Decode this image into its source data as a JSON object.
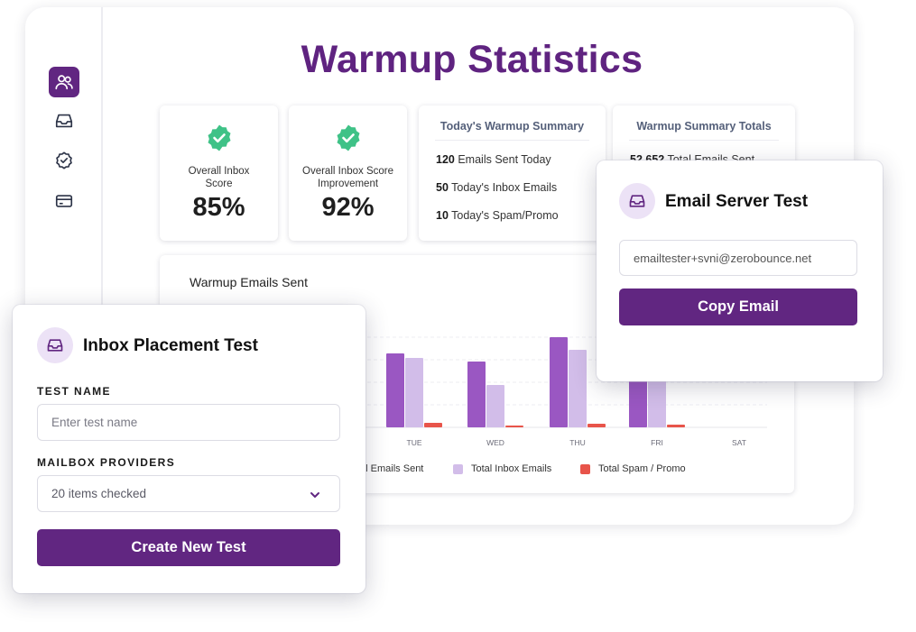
{
  "page": {
    "title": "Warmup Statistics"
  },
  "colors": {
    "brand": "#612681",
    "check_badge": "#3fc287",
    "sent_bar": "#9a57c2",
    "inbox_bar": "#d2bde9",
    "spam_bar": "#e8544a"
  },
  "sidebar": {
    "icons": [
      "users-icon",
      "inbox-icon",
      "badge-check-icon",
      "credit-card-icon"
    ],
    "active": "users-icon"
  },
  "score_cards": [
    {
      "label_line1": "Overall Inbox",
      "label_line2": "Score",
      "value": "85%"
    },
    {
      "label_line1": "Overall Inbox Score",
      "label_line2": "Improvement",
      "value": "92%"
    }
  ],
  "today_summary": {
    "title": "Today's Warmup Summary",
    "lines": [
      {
        "count": "120",
        "text": "Emails Sent Today"
      },
      {
        "count": "50",
        "text": "Today's Inbox Emails"
      },
      {
        "count": "10",
        "text": "Today's Spam/Promo"
      }
    ]
  },
  "totals_summary": {
    "title": "Warmup Summary Totals",
    "first_line": {
      "count": "52,652",
      "text": "Total Emails Sent"
    }
  },
  "chart_data": {
    "type": "bar",
    "title": "Warmup Emails Sent",
    "categories": [
      "TUE",
      "WED",
      "THU",
      "FRI",
      "SAT"
    ],
    "series": [
      {
        "name": "Total Emails Sent",
        "values": [
          82,
          73,
          100,
          88,
          0
        ]
      },
      {
        "name": "Total Inbox Emails",
        "values": [
          77,
          47,
          86,
          84,
          0
        ]
      },
      {
        "name": "Total Spam / Promo",
        "values": [
          5,
          2,
          4,
          3,
          0
        ]
      }
    ],
    "ylim": [
      0,
      110
    ],
    "grid": true,
    "legend_position": "bottom",
    "legend_visible_text": [
      "tal Emails Sent",
      "Total Inbox Emails",
      "Total Spam / Promo"
    ]
  },
  "inbox_placement": {
    "title": "Inbox Placement Test",
    "test_name_label": "TEST NAME",
    "test_name_placeholder": "Enter test name",
    "providers_label": "MAILBOX PROVIDERS",
    "providers_value": "20 items checked",
    "create_button": "Create New Test"
  },
  "email_server": {
    "title": "Email Server Test",
    "email": "emailtester+svni@zerobounce.net",
    "copy_button": "Copy Email"
  }
}
